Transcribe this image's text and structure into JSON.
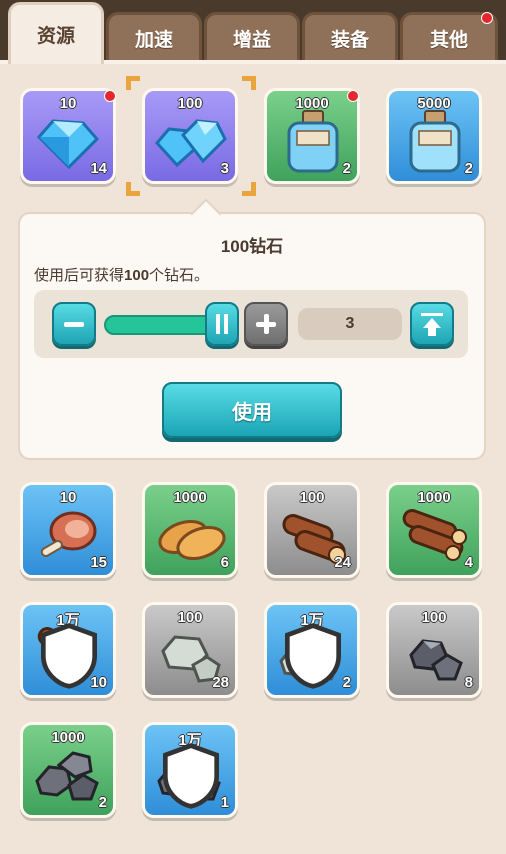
{
  "tabs": [
    {
      "label": "资源",
      "active": true
    },
    {
      "label": "加速",
      "active": false
    },
    {
      "label": "增益",
      "active": false
    },
    {
      "label": "装备",
      "active": false
    },
    {
      "label": "其他",
      "active": false,
      "badge": true
    }
  ],
  "top_items": [
    {
      "value": "10",
      "count": "14",
      "kind": "diamond",
      "color": "purple",
      "badge": true
    },
    {
      "value": "100",
      "count": "3",
      "kind": "diamond",
      "color": "purple",
      "selected": true
    },
    {
      "value": "1000",
      "count": "2",
      "kind": "potion",
      "color": "green",
      "badge": true
    },
    {
      "value": "5000",
      "count": "2",
      "kind": "potion",
      "color": "blue"
    }
  ],
  "popup": {
    "title": "100钻石",
    "description_prefix": "使用后可获得",
    "description_bold": "100",
    "description_suffix": "个钻石。",
    "quantity": "3",
    "slider_fraction": 0.75,
    "use_label": "使用"
  },
  "grid_items": [
    {
      "value": "10",
      "count": "15",
      "kind": "meat",
      "color": "blue"
    },
    {
      "value": "1000",
      "count": "6",
      "kind": "bread",
      "color": "green"
    },
    {
      "value": "100",
      "count": "24",
      "kind": "wood",
      "color": "gray"
    },
    {
      "value": "1000",
      "count": "4",
      "kind": "wood",
      "color": "green"
    },
    {
      "value": "1万",
      "count": "10",
      "kind": "wood",
      "color": "blue",
      "shield": true
    },
    {
      "value": "100",
      "count": "28",
      "kind": "stone",
      "color": "gray"
    },
    {
      "value": "1万",
      "count": "2",
      "kind": "stone",
      "color": "blue",
      "shield": true
    },
    {
      "value": "100",
      "count": "8",
      "kind": "ore",
      "color": "gray"
    },
    {
      "value": "1000",
      "count": "2",
      "kind": "ore",
      "color": "green"
    },
    {
      "value": "1万",
      "count": "1",
      "kind": "ore",
      "color": "blue",
      "shield": true
    }
  ]
}
